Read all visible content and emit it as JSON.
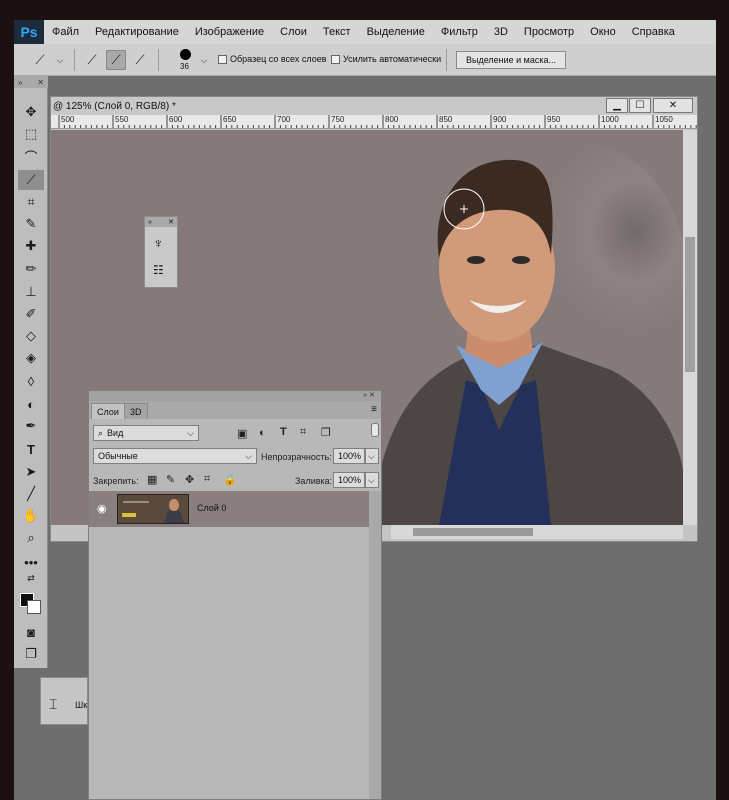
{
  "app": {
    "logo": "Ps"
  },
  "menu": [
    "Файл",
    "Редактирование",
    "Изображение",
    "Слои",
    "Текст",
    "Выделение",
    "Фильтр",
    "3D",
    "Просмотр",
    "Окно",
    "Справка"
  ],
  "options": {
    "brush_size": "36",
    "sample_all_label": "Образец со всех слоев",
    "auto_enhance_label": "Усилить автоматически",
    "select_mask_label": "Выделение и маска..."
  },
  "document": {
    "title": "@ 125% (Слой 0, RGB/8) *",
    "ruler": [
      "500",
      "550",
      "600",
      "650",
      "700",
      "750",
      "800",
      "850",
      "900",
      "950",
      "1000",
      "1050"
    ]
  },
  "layers_panel": {
    "tabs": [
      "Слои",
      "3D"
    ],
    "filter_label": "Вид",
    "blend_mode": "Обычные",
    "opacity_label": "Непрозрачность:",
    "opacity_value": "100%",
    "lock_label": "Закрепить:",
    "fill_label": "Заливка:",
    "fill_value": "100%",
    "layer_name": "Слой 0"
  },
  "small_panel": {
    "label": "Шк"
  },
  "colors": {
    "foreground": "#111111",
    "background": "#ffffff",
    "canvas_bg": "#847a79"
  },
  "toolbar_icons": [
    "move-icon",
    "marquee-icon",
    "lasso-icon",
    "quick-selection-icon",
    "crop-icon",
    "eyedropper-icon",
    "healing-icon",
    "brush-icon",
    "stamp-icon",
    "history-brush-icon",
    "eraser-icon",
    "paint-bucket-icon",
    "blur-icon",
    "dodge-icon",
    "pen-icon",
    "type-icon",
    "path-selection-icon",
    "line-icon",
    "hand-icon",
    "zoom-icon",
    "more-tools-icon"
  ]
}
